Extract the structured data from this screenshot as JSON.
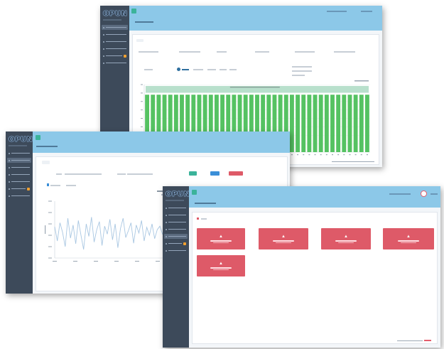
{
  "brand": {
    "logo": "OPUN"
  },
  "colors": {
    "sidebar": "#3d4a5a",
    "topbar": "#8cc8e8",
    "bar_fill": "#55c262",
    "bar_band": "#b8e0cc",
    "line_series": "#a9c7e2",
    "alarm_card": "#de5a68",
    "accent_green": "#3bb39a"
  },
  "windows": {
    "top": {
      "nav_items": 6,
      "active_index": 0,
      "badge_index": 4
    },
    "left": {
      "nav_items": 7,
      "active_index": 1,
      "badge_index": 5
    },
    "right": {
      "nav_items": 7,
      "active_index": 4,
      "badge_index": 5,
      "alarm_cards": 5
    }
  },
  "chart_data": [
    {
      "type": "bar",
      "window": "top",
      "categories_count": 39,
      "values": [
        0.85,
        0.85,
        0.85,
        0.85,
        0.85,
        0.85,
        0.85,
        0.85,
        0.85,
        0.85,
        0.85,
        0.85,
        0.85,
        0.85,
        0.85,
        0.85,
        0.85,
        0.85,
        0.85,
        0.85,
        0.85,
        0.85,
        0.85,
        0.85,
        0.85,
        0.85,
        0.85,
        0.85,
        0.85,
        0.85,
        0.85,
        0.85,
        0.85,
        0.85,
        0.85,
        0.85,
        0.85,
        0.85,
        0.85
      ],
      "ylim": [
        0,
        1
      ]
    },
    {
      "type": "line",
      "window": "left",
      "values": [
        0.55,
        0.3,
        0.62,
        0.45,
        0.2,
        0.7,
        0.35,
        0.58,
        0.25,
        0.66,
        0.4,
        0.15,
        0.6,
        0.38,
        0.72,
        0.28,
        0.5,
        0.64,
        0.22,
        0.56,
        0.42,
        0.68,
        0.32,
        0.6,
        0.18,
        0.52,
        0.7,
        0.36,
        0.48,
        0.62,
        0.26,
        0.58,
        0.44,
        0.66,
        0.3,
        0.54,
        0.4,
        0.6,
        0.34,
        0.5,
        0.56,
        0.42,
        0.48,
        0.52,
        0.38,
        0.58,
        0.46,
        0.5
      ],
      "ylim": [
        0,
        1
      ]
    }
  ]
}
